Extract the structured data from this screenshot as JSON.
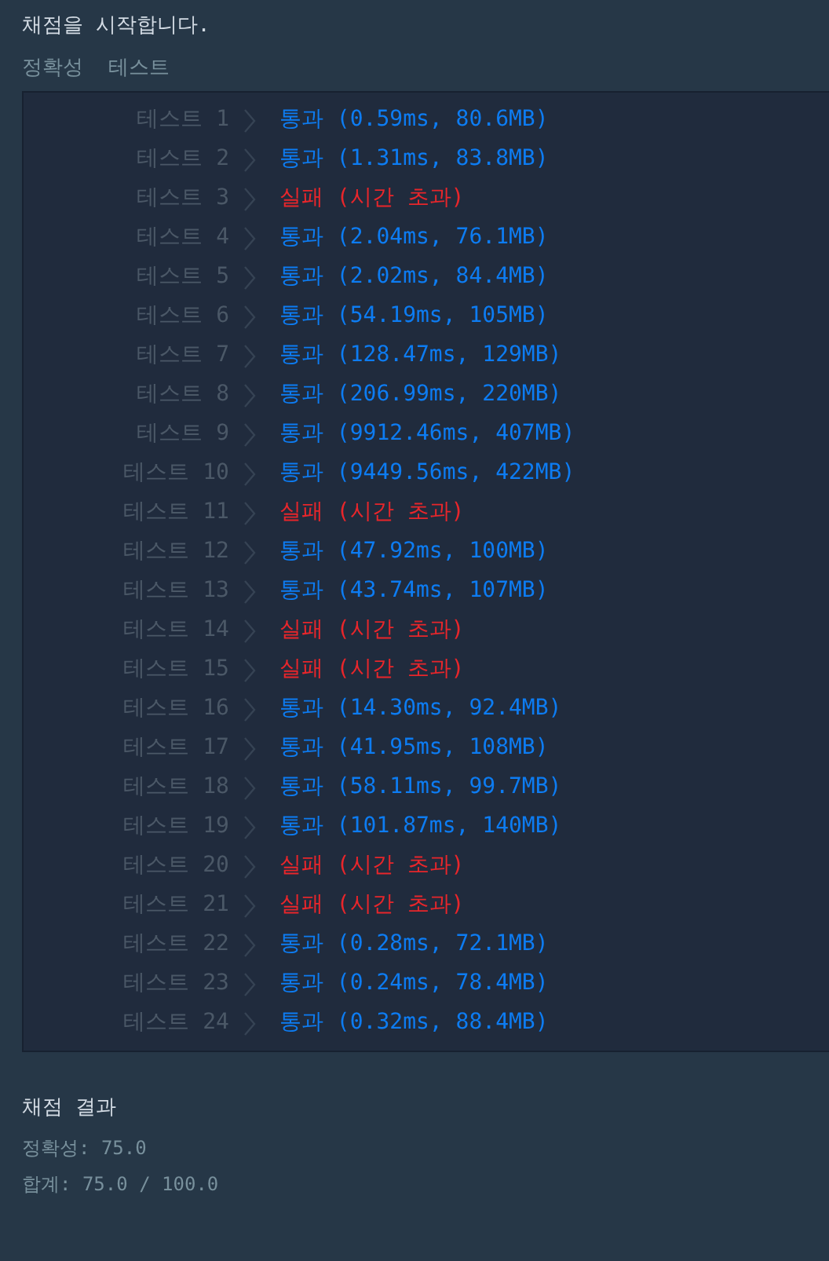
{
  "heading": "채점을 시작합니다.",
  "tabs": [
    "정확성",
    "테스트"
  ],
  "tests": [
    {
      "label": "테스트 1",
      "kind": "pass",
      "result": "통과 (0.59ms, 80.6MB)"
    },
    {
      "label": "테스트 2",
      "kind": "pass",
      "result": "통과 (1.31ms, 83.8MB)"
    },
    {
      "label": "테스트 3",
      "kind": "fail",
      "result": "실패 (시간 초과)"
    },
    {
      "label": "테스트 4",
      "kind": "pass",
      "result": "통과 (2.04ms, 76.1MB)"
    },
    {
      "label": "테스트 5",
      "kind": "pass",
      "result": "통과 (2.02ms, 84.4MB)"
    },
    {
      "label": "테스트 6",
      "kind": "pass",
      "result": "통과 (54.19ms, 105MB)"
    },
    {
      "label": "테스트 7",
      "kind": "pass",
      "result": "통과 (128.47ms, 129MB)"
    },
    {
      "label": "테스트 8",
      "kind": "pass",
      "result": "통과 (206.99ms, 220MB)"
    },
    {
      "label": "테스트 9",
      "kind": "pass",
      "result": "통과 (9912.46ms, 407MB)"
    },
    {
      "label": "테스트 10",
      "kind": "pass",
      "result": "통과 (9449.56ms, 422MB)"
    },
    {
      "label": "테스트 11",
      "kind": "fail",
      "result": "실패 (시간 초과)"
    },
    {
      "label": "테스트 12",
      "kind": "pass",
      "result": "통과 (47.92ms, 100MB)"
    },
    {
      "label": "테스트 13",
      "kind": "pass",
      "result": "통과 (43.74ms, 107MB)"
    },
    {
      "label": "테스트 14",
      "kind": "fail",
      "result": "실패 (시간 초과)"
    },
    {
      "label": "테스트 15",
      "kind": "fail",
      "result": "실패 (시간 초과)"
    },
    {
      "label": "테스트 16",
      "kind": "pass",
      "result": "통과 (14.30ms, 92.4MB)"
    },
    {
      "label": "테스트 17",
      "kind": "pass",
      "result": "통과 (41.95ms, 108MB)"
    },
    {
      "label": "테스트 18",
      "kind": "pass",
      "result": "통과 (58.11ms, 99.7MB)"
    },
    {
      "label": "테스트 19",
      "kind": "pass",
      "result": "통과 (101.87ms, 140MB)"
    },
    {
      "label": "테스트 20",
      "kind": "fail",
      "result": "실패 (시간 초과)"
    },
    {
      "label": "테스트 21",
      "kind": "fail",
      "result": "실패 (시간 초과)"
    },
    {
      "label": "테스트 22",
      "kind": "pass",
      "result": "통과 (0.28ms, 72.1MB)"
    },
    {
      "label": "테스트 23",
      "kind": "pass",
      "result": "통과 (0.24ms, 78.4MB)"
    },
    {
      "label": "테스트 24",
      "kind": "pass",
      "result": "통과 (0.32ms, 88.4MB)"
    }
  ],
  "summary": {
    "title": "채점 결과",
    "lines": [
      "정확성: 75.0",
      "합계: 75.0 / 100.0"
    ]
  }
}
